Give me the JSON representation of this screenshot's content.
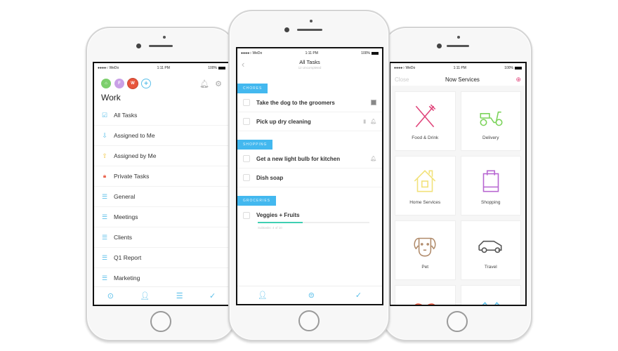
{
  "status_bar": {
    "carrier": "●●●●○ WeDo",
    "wifi": "wifi",
    "time": "1:11 PM",
    "battery": "100%"
  },
  "left_phone": {
    "workspaces": [
      {
        "letter": "⌂",
        "color": "#7ccf6c"
      },
      {
        "letter": "F",
        "color": "#c9a0e6"
      },
      {
        "letter": "W",
        "color": "#e8553c"
      },
      {
        "letter": "+",
        "color": "#5bbfea"
      }
    ],
    "title": "Work",
    "items": [
      {
        "label": "All Tasks",
        "icon": "checkbox-icon",
        "glyph": "☑",
        "color": "#5bbfea"
      },
      {
        "label": "Assigned to Me",
        "icon": "assigned-in-icon",
        "glyph": "⇩",
        "color": "#5bbfea"
      },
      {
        "label": "Assigned by Me",
        "icon": "assigned-out-icon",
        "glyph": "⇧",
        "color": "#f2c94c"
      },
      {
        "label": "Private Tasks",
        "icon": "lock-icon",
        "glyph": "🔒",
        "color": "#e8553c"
      },
      {
        "label": "General",
        "icon": "list-icon",
        "glyph": "☰",
        "color": "#5bbfea"
      },
      {
        "label": "Meetings",
        "icon": "list-icon",
        "glyph": "☰",
        "color": "#5bbfea"
      },
      {
        "label": "Clients",
        "icon": "list-icon",
        "glyph": "☰",
        "color": "#5bbfea"
      },
      {
        "label": "Q1 Report",
        "icon": "list-icon",
        "glyph": "☰",
        "color": "#5bbfea"
      },
      {
        "label": "Marketing",
        "icon": "list-icon",
        "glyph": "☰",
        "color": "#5bbfea"
      }
    ],
    "bottom_bar": [
      "location-icon",
      "add-user-icon",
      "add-list-icon",
      "add-task-icon"
    ]
  },
  "mid_phone": {
    "title": "All Tasks",
    "subtitle": "12 Uncompleted",
    "sections": [
      {
        "label": "CHORES",
        "tasks": [
          {
            "text": "Take the dog to the groomers",
            "meta": "avatar"
          },
          {
            "text": "Pick up dry cleaning",
            "meta": "note-bell"
          }
        ]
      },
      {
        "label": "SHOPPING",
        "tasks": [
          {
            "text": "Get a new light bulb for kitchen",
            "meta": "bell"
          },
          {
            "text": "Dish soap",
            "meta": ""
          }
        ]
      },
      {
        "label": "GROCERIES",
        "tasks": [
          {
            "text": "Veggies + Fruits",
            "meta": "",
            "subtasks_done": 4,
            "subtasks_total": 10,
            "subtasks_text": "Subtasks: 4 of 10"
          }
        ]
      }
    ]
  },
  "right_phone": {
    "close_label": "Close",
    "title": "Now Services",
    "tiles": [
      {
        "label": "Food & Drink",
        "color": "#e0457b"
      },
      {
        "label": "Delivery",
        "color": "#7bd35a"
      },
      {
        "label": "Home Services",
        "color": "#f2e27a"
      },
      {
        "label": "Shopping",
        "color": "#b766d1"
      },
      {
        "label": "Pet",
        "color": "#b08a6a"
      },
      {
        "label": "Travel",
        "color": "#555555"
      },
      {
        "label": "",
        "color": "#e8553c"
      },
      {
        "label": "",
        "color": "#5bbfea"
      }
    ]
  }
}
